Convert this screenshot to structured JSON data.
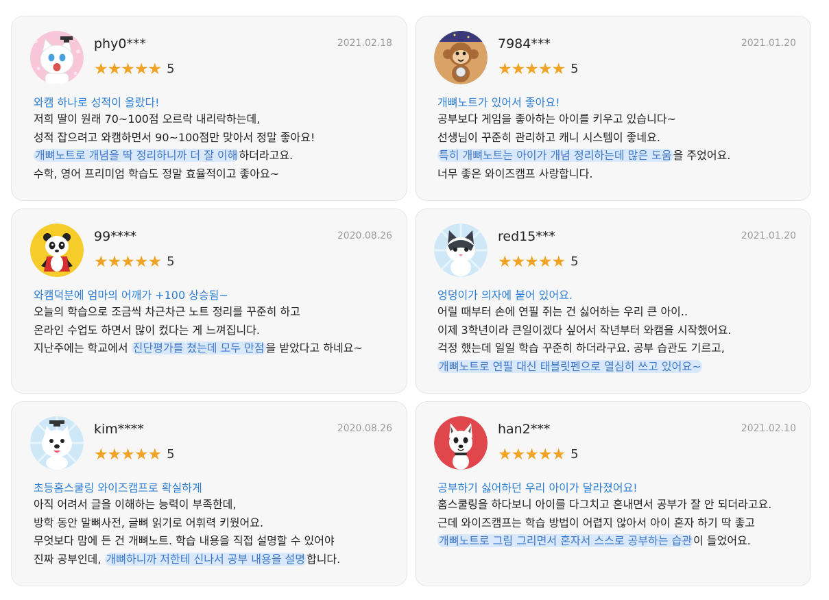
{
  "colors": {
    "star": "#f0a325",
    "headline": "#2d7fd6",
    "highlight_bg": "#d9e8fb",
    "highlight_text": "#3f78c7",
    "date": "#9a9a9a"
  },
  "reviews": [
    {
      "user": "phy0***",
      "date": "2021.02.18",
      "stars": "★★★★★",
      "rating": "5",
      "avatar": "cat-graduate-icon",
      "headline": "와캠 하나로 성적이 올랐다!",
      "lines": [
        {
          "pre": "저희 딸이 원래 70~100점 오르락 내리락하는데,",
          "hl": "",
          "post": ""
        },
        {
          "pre": "성적 잡으려고 와캠하면서 90~100점만 맞아서 정말 좋아요!",
          "hl": "",
          "post": ""
        },
        {
          "pre": "",
          "hl": "개뼈노트로 개념을 딱 정리하니까 더 잘 이해",
          "post": "하더라고요."
        },
        {
          "pre": "수학, 영어 프리미엄 학습도 정말 효율적이고 좋아요~",
          "hl": "",
          "post": ""
        }
      ]
    },
    {
      "user": "7984***",
      "date": "2021.01.20",
      "stars": "★★★★★",
      "rating": "5",
      "avatar": "monkey-icon",
      "headline": "개뼈노트가 있어서 좋아요!",
      "lines": [
        {
          "pre": "공부보다 게임을 좋아하는 아이를 키우고 있습니다~",
          "hl": "",
          "post": ""
        },
        {
          "pre": "선생님이 꾸준히 관리하고 캐니 시스템이 좋네요.",
          "hl": "",
          "post": ""
        },
        {
          "pre": "",
          "hl": "특히 개뼈노트는 아이가 개념 정리하는데 많은 도움",
          "post": "을 주었어요."
        },
        {
          "pre": "너무 좋은 와이즈캠프 사랑합니다.",
          "hl": "",
          "post": ""
        }
      ]
    },
    {
      "user": "99****",
      "date": "2020.08.26",
      "stars": "★★★★★",
      "rating": "5",
      "avatar": "panda-icon",
      "headline": "와캠덕분에 엄마의 어깨가 +100 상승됨~",
      "lines": [
        {
          "pre": "오늘의 학습으로 조금씩 차근차근 노트 정리를 꾸준히 하고",
          "hl": "",
          "post": ""
        },
        {
          "pre": "온라인 수업도 하면서 많이 컸다는 게 느껴집니다.",
          "hl": "",
          "post": ""
        },
        {
          "pre": "지난주에는 학교에서 ",
          "hl": "진단평가를 쳤는데 모두 만점",
          "post": "을 받았다고 하네요~"
        }
      ]
    },
    {
      "user": "red15***",
      "date": "2021.01.20",
      "stars": "★★★★★",
      "rating": "5",
      "avatar": "siamese-cat-icon",
      "headline": "엉덩이가 의자에 붙어 있어요.",
      "lines": [
        {
          "pre": "어릴 때부터 손에 연필 쥐는 건 싫어하는 우리 큰 아이..",
          "hl": "",
          "post": ""
        },
        {
          "pre": "이제 3학년이라 큰일이겠다 싶어서 작년부터 와캠을 시작했어요.",
          "hl": "",
          "post": ""
        },
        {
          "pre": "걱정 했는데 일일 학습 꾸준히 하더라구요. 공부 습관도 기르고,",
          "hl": "",
          "post": ""
        },
        {
          "pre": "",
          "hl": "개뼈노트로 연필 대신 태블릿펜으로 열심히 쓰고 있어요~",
          "post": ""
        }
      ]
    },
    {
      "user": "kim****",
      "date": "2020.08.26",
      "stars": "★★★★★",
      "rating": "5",
      "avatar": "dog-graduate-icon",
      "headline": "초등홈스쿨링 와이즈캠프로 확실하게",
      "lines": [
        {
          "pre": "아직 어려서 글을 이해하는 능력이 부족한데,",
          "hl": "",
          "post": ""
        },
        {
          "pre": "방학 동안 말뼈사전, 글뼈 읽기로 어휘력 키웠어요.",
          "hl": "",
          "post": ""
        },
        {
          "pre": "무엇보다 맘에 든 건 개뼈노트. 학습 내용을 직접 설명할 수 있어야",
          "hl": "",
          "post": ""
        },
        {
          "pre": "진짜 공부인데, ",
          "hl": "개뼈하니까 저한테 신나서 공부 내용을 설명",
          "post": "합니다."
        }
      ]
    },
    {
      "user": "han2***",
      "date": "2021.02.10",
      "stars": "★★★★★",
      "rating": "5",
      "avatar": "dog-red-icon",
      "headline": "공부하기 싫어하던 우리 아이가 달라졌어요!",
      "lines": [
        {
          "pre": "홈스쿨링을 하다보니 아이를 다그치고 혼내면서 공부가 잘 안 되더라고요.",
          "hl": "",
          "post": ""
        },
        {
          "pre": "근데 와이즈캠프는 학습 방법이 어렵지 않아서 아이 혼자 하기 딱 좋고",
          "hl": "",
          "post": ""
        },
        {
          "pre": "",
          "hl": "개뼈노트로 그림 그리면서 혼자서 스스로 공부하는 습관",
          "post": "이 들었어요."
        }
      ]
    }
  ]
}
